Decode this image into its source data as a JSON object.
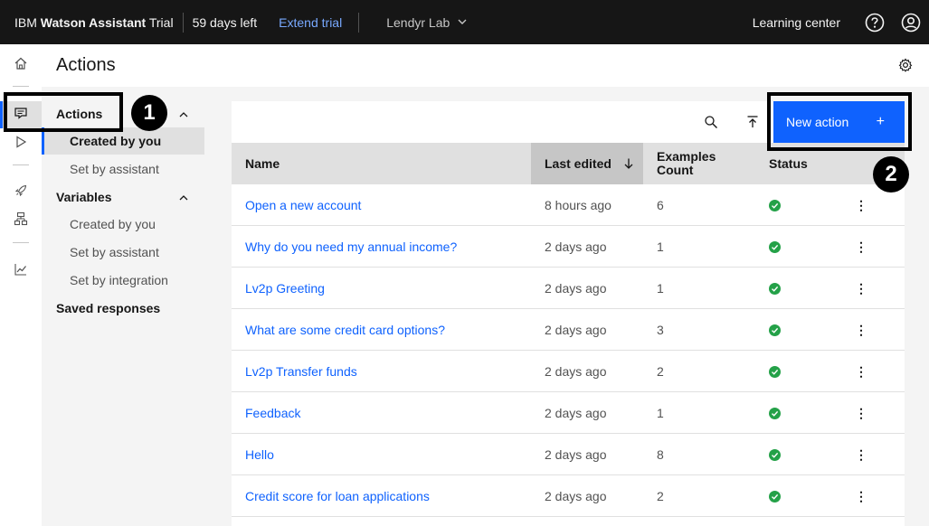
{
  "topbar": {
    "brand_ibm": "IBM",
    "brand_product": "Watson Assistant",
    "brand_plan": "Trial",
    "trial_days": "59 days left",
    "extend_trial": "Extend trial",
    "workspace": "Lendyr Lab",
    "learning_center": "Learning center"
  },
  "header": {
    "title": "Actions"
  },
  "sidenav": {
    "actions_label": "Actions",
    "actions_items": [
      "Created by you",
      "Set by assistant"
    ],
    "variables_label": "Variables",
    "variables_items": [
      "Created by you",
      "Set by assistant",
      "Set by integration"
    ],
    "saved_responses_label": "Saved responses"
  },
  "toolbar": {
    "new_action_label": "New action",
    "plus": "+"
  },
  "table": {
    "columns": {
      "name": "Name",
      "last_edited": "Last edited",
      "examples_count_line1": "Examples",
      "examples_count_line2": "Count",
      "status": "Status"
    },
    "rows": [
      {
        "name": "Open a new account",
        "last_edited": "8 hours ago",
        "count": "6",
        "status": "ok"
      },
      {
        "name": "Why do you need my annual income?",
        "last_edited": "2 days ago",
        "count": "1",
        "status": "ok"
      },
      {
        "name": "Lv2p Greeting",
        "last_edited": "2 days ago",
        "count": "1",
        "status": "ok"
      },
      {
        "name": "What are some credit card options?",
        "last_edited": "2 days ago",
        "count": "3",
        "status": "ok"
      },
      {
        "name": "Lv2p Transfer funds",
        "last_edited": "2 days ago",
        "count": "2",
        "status": "ok"
      },
      {
        "name": "Feedback",
        "last_edited": "2 days ago",
        "count": "1",
        "status": "ok"
      },
      {
        "name": "Hello",
        "last_edited": "2 days ago",
        "count": "8",
        "status": "ok"
      },
      {
        "name": "Credit score for loan applications",
        "last_edited": "2 days ago",
        "count": "2",
        "status": "ok"
      }
    ]
  },
  "annotations": {
    "badge_1": "1",
    "badge_2": "2"
  },
  "colors": {
    "accent": "#0f62fe",
    "status_ok": "#24a148",
    "topbar_bg": "#161616"
  }
}
